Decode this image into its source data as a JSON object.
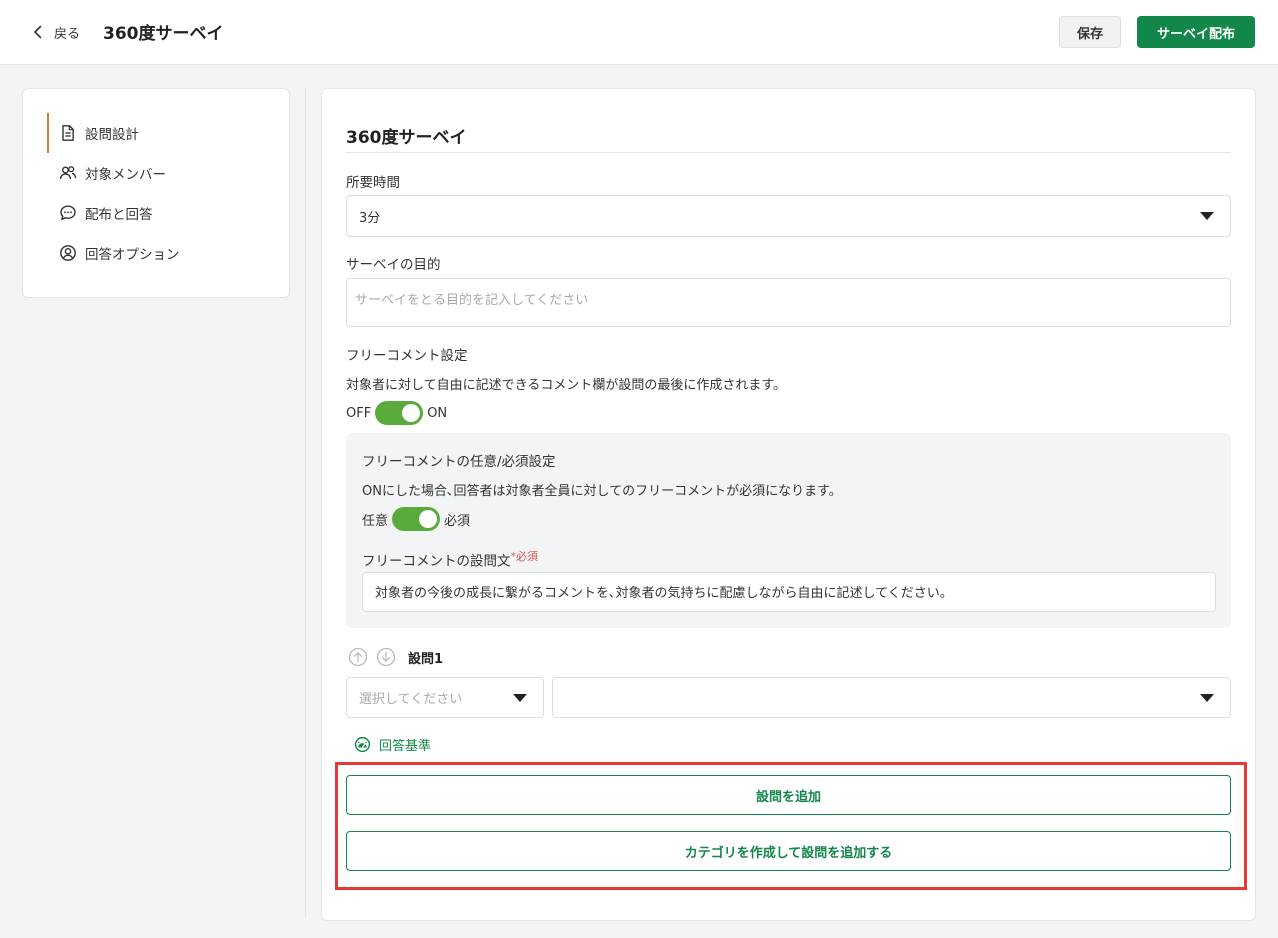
{
  "header": {
    "back_label": "戻る",
    "title": "360度サーベイ",
    "save_label": "保存",
    "distribute_label": "サーベイ配布"
  },
  "sidebar": {
    "items": [
      {
        "label": "設問設計",
        "icon": "document-icon",
        "active": true
      },
      {
        "label": "対象メンバー",
        "icon": "users-icon"
      },
      {
        "label": "配布と回答",
        "icon": "chat-icon"
      },
      {
        "label": "回答オプション",
        "icon": "user-circle-icon"
      }
    ]
  },
  "main": {
    "title": "360度サーベイ",
    "duration": {
      "label": "所要時間",
      "value": "3分"
    },
    "purpose": {
      "label": "サーベイの目的",
      "placeholder": "サーベイをとる目的を記入してください"
    },
    "free_comment": {
      "label": "フリーコメント設定",
      "description": "対象者に対して自由に記述できるコメント欄が設問の最後に作成されます。",
      "off_label": "OFF",
      "on_label": "ON",
      "enabled": true,
      "required_setting": {
        "label": "フリーコメントの任意/必須設定",
        "description": "ONにした場合､回答者は対象者全員に対してのフリーコメントが必須になります。",
        "optional_label": "任意",
        "required_label": "必須",
        "enabled": true
      },
      "question_text": {
        "label": "フリーコメントの設問文",
        "required_mark": "*必須",
        "value": "対象者の今後の成長に繋がるコメントを､対象者の気持ちに配慮しながら自由に記述してください。"
      }
    },
    "question": {
      "label": "設問1",
      "type_placeholder": "選択してください",
      "second_value": ""
    },
    "criteria_label": "回答基準",
    "add_question_label": "設問を追加",
    "add_category_label": "カテゴリを作成して設問を追加する"
  },
  "colors": {
    "accent_green": "#13874a",
    "toggle_green": "#5aab3b",
    "active_orange": "#d9773a",
    "highlight_red": "#e53935",
    "required_red": "#d9534f"
  }
}
